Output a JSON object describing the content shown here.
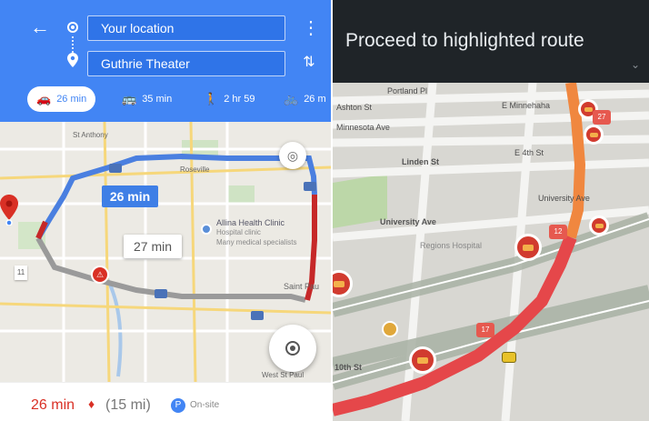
{
  "google_maps": {
    "origin": "Your location",
    "destination": "Guthrie Theater",
    "modes": [
      {
        "icon": "car-icon",
        "label": "26 min"
      },
      {
        "icon": "transit-icon",
        "label": "35 min"
      },
      {
        "icon": "walk-icon",
        "label": "2 hr 59"
      },
      {
        "icon": "bike-icon",
        "label": "26 m"
      }
    ],
    "map": {
      "primary_route_time": "26 min",
      "alt_route_time": "27 min",
      "labels": {
        "st_anthony": "St Anthony",
        "roseville": "Roseville",
        "poi_title": "Allina Health Clinic",
        "poi_sub": "Hospital clinic",
        "poi_desc": "Many medical specialists",
        "saint_paul": "Saint Pau",
        "west_st_paul": "West St Paul",
        "side_chip": "11"
      }
    },
    "summary": {
      "time": "26 min",
      "trend": "♦",
      "distance": "(15 mi)",
      "note": "On-site"
    }
  },
  "waze": {
    "banner_text": "Proceed to highlighted route",
    "streets": [
      "Portland Pl",
      "Ashton St",
      "E Minnehaha",
      "Minnesota Ave",
      "Linden St",
      "E 4th St",
      "University Ave",
      "University Ave",
      "Regions Hospital",
      "10th St"
    ],
    "badges": [
      "12",
      "17",
      "27"
    ]
  },
  "colors": {
    "gm_blue": "#4285f4",
    "traffic_red": "#d93025",
    "waze_banner": "#1f2428",
    "waze_route_orange": "#f0873f",
    "waze_route_red": "#e5474a"
  }
}
